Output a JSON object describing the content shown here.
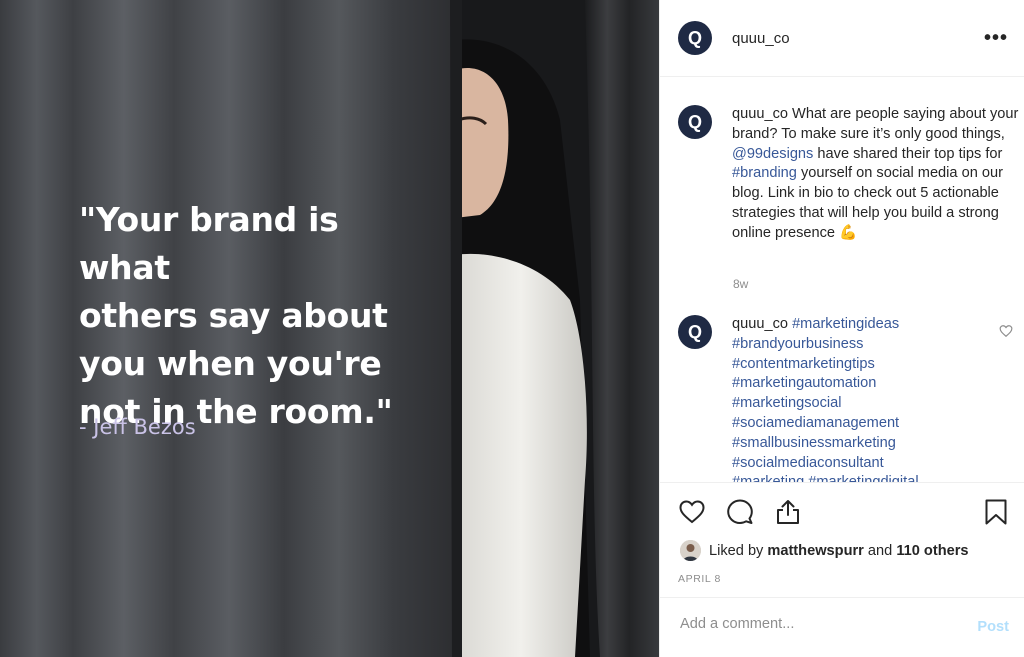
{
  "post": {
    "quote_lines": [
      "\"Your brand is what",
      "others say about",
      "you when you're",
      "not in the room.\""
    ],
    "author": "- Jeff Bezos"
  },
  "header": {
    "avatar_letter": "Q",
    "username": "quuu_co",
    "more": "•••"
  },
  "caption": {
    "username": "quuu_co",
    "part1": " What are people saying about your brand? To make sure it’s only good things, ",
    "mention": "@99designs",
    "part2": " have shared their top tips for ",
    "hashtag": "#branding",
    "part3": " yourself on social media on our blog. Link in bio to check out 5 actionable strategies that will help you build a strong online presence ",
    "emoji": "💪",
    "age": "8w"
  },
  "comment": {
    "username": "quuu_co",
    "hashtags": [
      "#marketingideas",
      "#brandyourbusiness",
      "#contentmarketingtips",
      "#marketingautomation",
      "#marketingsocial",
      "#sociamediamanagement",
      "#smallbusinessmarketing",
      "#socialmediaconsultant",
      "#marketing #marketingdigital"
    ]
  },
  "likes": {
    "prefix": "Liked by ",
    "user": "matthewspurr",
    "and": " and ",
    "others": "110 others"
  },
  "date": "APRIL 8",
  "add_comment": {
    "placeholder": "Add a comment...",
    "post_label": "Post"
  },
  "colors": {
    "link": "#385898",
    "avatar_bg": "#1f2a44",
    "post_disabled": "#b2dffc"
  },
  "icons": [
    "heart-icon",
    "comment-icon",
    "share-icon",
    "bookmark-icon",
    "more-icon",
    "small-heart-icon"
  ]
}
